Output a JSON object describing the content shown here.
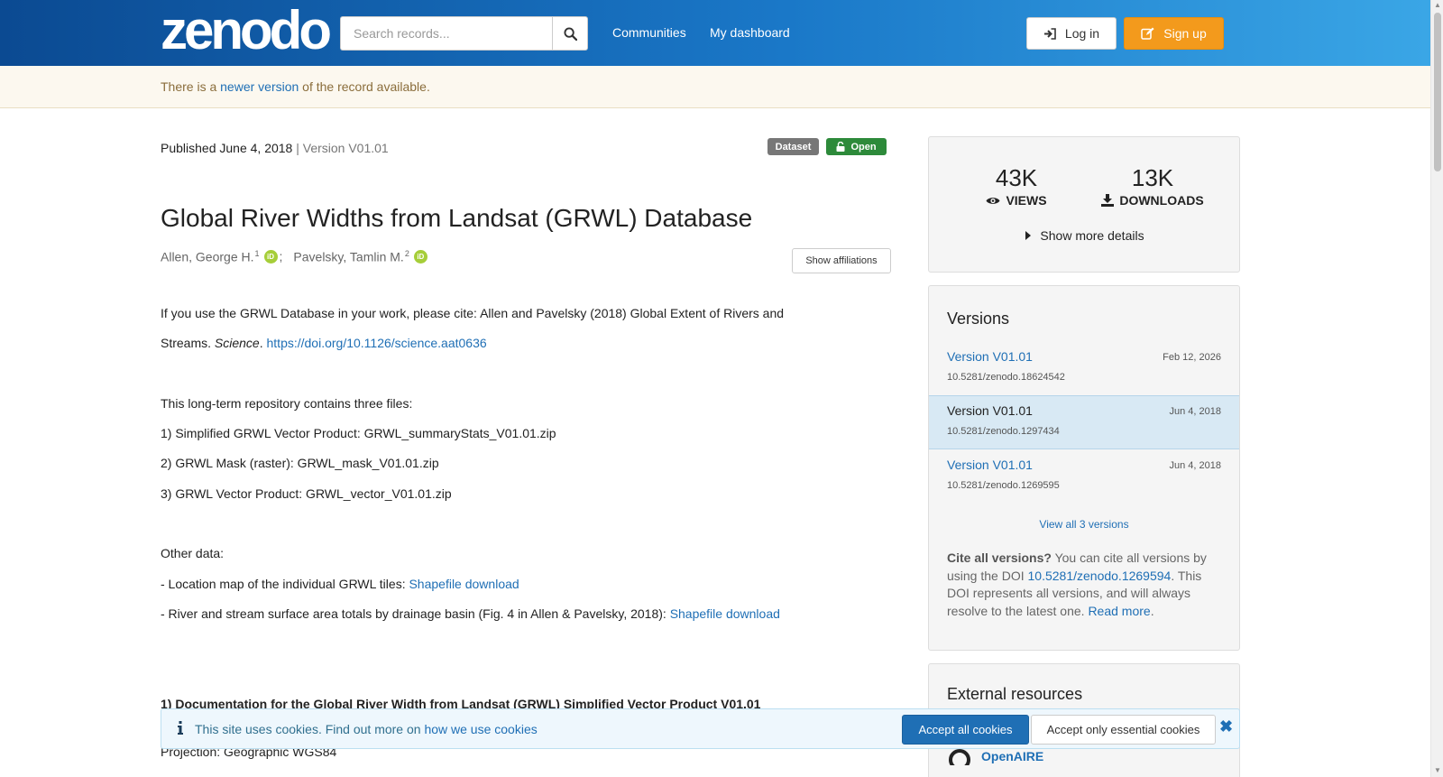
{
  "header": {
    "logo_text": "zenodo",
    "search_placeholder": "Search records...",
    "nav": [
      "Communities",
      "My dashboard"
    ],
    "login_label": "Log in",
    "signup_label": "Sign up"
  },
  "notice": {
    "prefix": "There is a ",
    "link": "newer version",
    "suffix": " of the record available."
  },
  "record": {
    "published": "Published June 4, 2018",
    "version": "| Version V01.01",
    "badge_type": "Dataset",
    "badge_access": "Open",
    "title": "Global River Widths from Landsat (GRWL) Database",
    "authors": [
      {
        "name": "Allen, George H.",
        "aff": "1"
      },
      {
        "name": "Pavelsky, Tamlin M.",
        "aff": "2"
      }
    ],
    "author_separator": ";",
    "orcid_label": "iD",
    "show_affiliations": "Show affiliations"
  },
  "description": {
    "cite_line1": "If you use the GRWL Database in your work, please cite: Allen and Pavelsky (2018) Global Extent of Rivers and",
    "cite_line2_prefix": "Streams. ",
    "cite_journal": "Science",
    "cite_dot": ". ",
    "cite_doi": "https://doi.org/10.1126/science.aat0636",
    "files_intro": "This long-term repository contains three files:",
    "file1": "1) Simplified GRWL Vector Product: GRWL_summaryStats_V01.01.zip",
    "file2": "2) GRWL Mask (raster): GRWL_mask_V01.01.zip",
    "file3": "3) GRWL Vector Product: GRWL_vector_V01.01.zip",
    "other_data": "Other data:",
    "other1_text": "- Location map of the individual GRWL tiles: ",
    "other1_link": "Shapefile download",
    "other2_text": "- River and stream surface area totals by drainage basin (Fig. 4 in Allen & Pavelsky, 2018): ",
    "other2_link": "Shapefile download",
    "doc_heading": "1) Documentation for the Global River Width from Landsat (GRWL) Simplified Vector Product V01.01",
    "projection": "Projection: Geographic WGS84"
  },
  "stats": {
    "views_num": "43K",
    "views_label": "VIEWS",
    "downloads_num": "13K",
    "downloads_label": "DOWNLOADS",
    "show_more": "Show more details"
  },
  "versions": {
    "title": "Versions",
    "items": [
      {
        "name": "Version V01.01",
        "date": "Feb 12, 2026",
        "doi": "10.5281/zenodo.18624542"
      },
      {
        "name": "Version V01.01",
        "date": "Jun 4, 2018",
        "doi": "10.5281/zenodo.1297434"
      },
      {
        "name": "Version V01.01",
        "date": "Jun 4, 2018",
        "doi": "10.5281/zenodo.1269595"
      }
    ],
    "view_all": "View all 3 versions",
    "cite_all_bold": "Cite all versions?",
    "cite_all_text1": " You can cite all versions by using the DOI ",
    "cite_all_doi": "10.5281/zenodo.1269594",
    "cite_all_text2": ". This DOI represents all versions, and will always resolve to the latest one. ",
    "read_more": "Read more",
    "read_more_dot": "."
  },
  "external": {
    "title": "External resources",
    "openaire": "OpenAIRE"
  },
  "cookie": {
    "message": "This site uses cookies. Find out more on ",
    "link": "how we use cookies",
    "accept_all": "Accept all cookies",
    "accept_essential": "Accept only essential cookies",
    "close": "✖"
  },
  "colors": {
    "header_start": "#0b4a92",
    "header_end": "#3aa6e6",
    "link": "#1f6fb5",
    "signup": "#f39a1c",
    "open_badge": "#2d8a3a",
    "dataset_badge": "#777777"
  }
}
